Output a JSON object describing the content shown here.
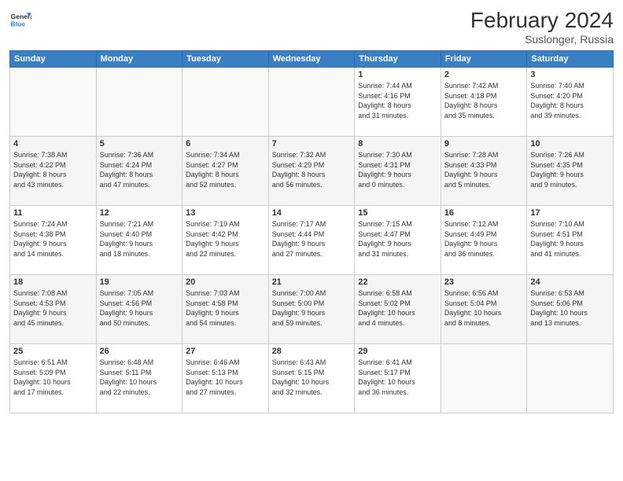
{
  "header": {
    "logo_general": "General",
    "logo_blue": "Blue",
    "month_title": "February 2024",
    "location": "Suslonger, Russia"
  },
  "days_of_week": [
    "Sunday",
    "Monday",
    "Tuesday",
    "Wednesday",
    "Thursday",
    "Friday",
    "Saturday"
  ],
  "weeks": [
    [
      {
        "day": "",
        "info": ""
      },
      {
        "day": "",
        "info": ""
      },
      {
        "day": "",
        "info": ""
      },
      {
        "day": "",
        "info": ""
      },
      {
        "day": "1",
        "info": "Sunrise: 7:44 AM\nSunset: 4:16 PM\nDaylight: 8 hours\nand 31 minutes."
      },
      {
        "day": "2",
        "info": "Sunrise: 7:42 AM\nSunset: 4:18 PM\nDaylight: 8 hours\nand 35 minutes."
      },
      {
        "day": "3",
        "info": "Sunrise: 7:40 AM\nSunset: 4:20 PM\nDaylight: 8 hours\nand 39 minutes."
      }
    ],
    [
      {
        "day": "4",
        "info": "Sunrise: 7:38 AM\nSunset: 4:22 PM\nDaylight: 8 hours\nand 43 minutes."
      },
      {
        "day": "5",
        "info": "Sunrise: 7:36 AM\nSunset: 4:24 PM\nDaylight: 8 hours\nand 47 minutes."
      },
      {
        "day": "6",
        "info": "Sunrise: 7:34 AM\nSunset: 4:27 PM\nDaylight: 8 hours\nand 52 minutes."
      },
      {
        "day": "7",
        "info": "Sunrise: 7:32 AM\nSunset: 4:29 PM\nDaylight: 8 hours\nand 56 minutes."
      },
      {
        "day": "8",
        "info": "Sunrise: 7:30 AM\nSunset: 4:31 PM\nDaylight: 9 hours\nand 0 minutes."
      },
      {
        "day": "9",
        "info": "Sunrise: 7:28 AM\nSunset: 4:33 PM\nDaylight: 9 hours\nand 5 minutes."
      },
      {
        "day": "10",
        "info": "Sunrise: 7:26 AM\nSunset: 4:35 PM\nDaylight: 9 hours\nand 9 minutes."
      }
    ],
    [
      {
        "day": "11",
        "info": "Sunrise: 7:24 AM\nSunset: 4:38 PM\nDaylight: 9 hours\nand 14 minutes."
      },
      {
        "day": "12",
        "info": "Sunrise: 7:21 AM\nSunset: 4:40 PM\nDaylight: 9 hours\nand 18 minutes."
      },
      {
        "day": "13",
        "info": "Sunrise: 7:19 AM\nSunset: 4:42 PM\nDaylight: 9 hours\nand 22 minutes."
      },
      {
        "day": "14",
        "info": "Sunrise: 7:17 AM\nSunset: 4:44 PM\nDaylight: 9 hours\nand 27 minutes."
      },
      {
        "day": "15",
        "info": "Sunrise: 7:15 AM\nSunset: 4:47 PM\nDaylight: 9 hours\nand 31 minutes."
      },
      {
        "day": "16",
        "info": "Sunrise: 7:12 AM\nSunset: 4:49 PM\nDaylight: 9 hours\nand 36 minutes."
      },
      {
        "day": "17",
        "info": "Sunrise: 7:10 AM\nSunset: 4:51 PM\nDaylight: 9 hours\nand 41 minutes."
      }
    ],
    [
      {
        "day": "18",
        "info": "Sunrise: 7:08 AM\nSunset: 4:53 PM\nDaylight: 9 hours\nand 45 minutes."
      },
      {
        "day": "19",
        "info": "Sunrise: 7:05 AM\nSunset: 4:56 PM\nDaylight: 9 hours\nand 50 minutes."
      },
      {
        "day": "20",
        "info": "Sunrise: 7:03 AM\nSunset: 4:58 PM\nDaylight: 9 hours\nand 54 minutes."
      },
      {
        "day": "21",
        "info": "Sunrise: 7:00 AM\nSunset: 5:00 PM\nDaylight: 9 hours\nand 59 minutes."
      },
      {
        "day": "22",
        "info": "Sunrise: 6:58 AM\nSunset: 5:02 PM\nDaylight: 10 hours\nand 4 minutes."
      },
      {
        "day": "23",
        "info": "Sunrise: 6:56 AM\nSunset: 5:04 PM\nDaylight: 10 hours\nand 8 minutes."
      },
      {
        "day": "24",
        "info": "Sunrise: 6:53 AM\nSunset: 5:06 PM\nDaylight: 10 hours\nand 13 minutes."
      }
    ],
    [
      {
        "day": "25",
        "info": "Sunrise: 6:51 AM\nSunset: 5:09 PM\nDaylight: 10 hours\nand 17 minutes."
      },
      {
        "day": "26",
        "info": "Sunrise: 6:48 AM\nSunset: 5:11 PM\nDaylight: 10 hours\nand 22 minutes."
      },
      {
        "day": "27",
        "info": "Sunrise: 6:46 AM\nSunset: 5:13 PM\nDaylight: 10 hours\nand 27 minutes."
      },
      {
        "day": "28",
        "info": "Sunrise: 6:43 AM\nSunset: 5:15 PM\nDaylight: 10 hours\nand 32 minutes."
      },
      {
        "day": "29",
        "info": "Sunrise: 6:41 AM\nSunset: 5:17 PM\nDaylight: 10 hours\nand 36 minutes."
      },
      {
        "day": "",
        "info": ""
      },
      {
        "day": "",
        "info": ""
      }
    ]
  ]
}
